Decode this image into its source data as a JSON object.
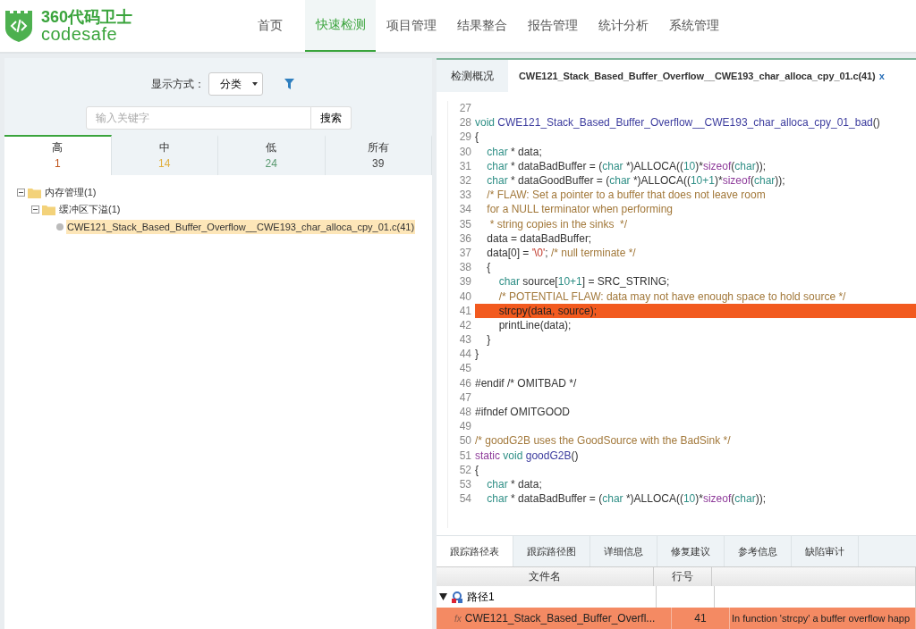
{
  "logo": {
    "title": "360代码卫士",
    "subtitle": "codesafe"
  },
  "nav": [
    {
      "label": "首页",
      "selected": false
    },
    {
      "label": "快速检测",
      "selected": true
    },
    {
      "label": "项目管理",
      "selected": false
    },
    {
      "label": "结果整合",
      "selected": false
    },
    {
      "label": "报告管理",
      "selected": false
    },
    {
      "label": "统计分析",
      "selected": false
    },
    {
      "label": "系统管理",
      "selected": false
    }
  ],
  "left": {
    "display_mode": {
      "label": "显示方式：",
      "value": "分类"
    },
    "search": {
      "placeholder": "输入关键字",
      "button": "搜索"
    },
    "severity_tabs": [
      {
        "label": "高",
        "count": "1",
        "color": "#c0561e",
        "selected": true
      },
      {
        "label": "中",
        "count": "14",
        "color": "#e0b040",
        "selected": false
      },
      {
        "label": "低",
        "count": "24",
        "color": "#5a9a70",
        "selected": false
      },
      {
        "label": "所有",
        "count": "39",
        "color": "#444444",
        "selected": false
      }
    ],
    "tree": [
      {
        "label": "内存管理(1)",
        "kind": "folder",
        "expanded": true,
        "selected": false,
        "children": [
          {
            "label": "缓冲区下溢(1)",
            "kind": "folder",
            "expanded": true,
            "selected": false,
            "children": [
              {
                "label": "CWE121_Stack_Based_Buffer_Overflow__CWE193_char_alloca_cpy_01.c(41)",
                "kind": "file",
                "selected": true
              }
            ]
          }
        ]
      }
    ]
  },
  "right": {
    "tabs": [
      {
        "label": "检测概况",
        "selected": false,
        "closable": false
      },
      {
        "label": "CWE121_Stack_Based_Buffer_Overflow__CWE193_char_alloca_cpy_01.c(41)",
        "selected": true,
        "closable": true,
        "close": "x"
      }
    ],
    "code": [
      {
        "num": "27",
        "highlight": false
      },
      {
        "num": "28",
        "highlight": false,
        "segs": [
          {
            "kind": "kw",
            "t": "void "
          },
          {
            "kind": "fn",
            "t": "CWE121_Stack_Based_Buffer_Overflow__CWE193_char_alloca_cpy_01_bad"
          },
          {
            "kind": "p",
            "t": "()"
          }
        ]
      },
      {
        "num": "29",
        "highlight": false,
        "segs": [
          {
            "kind": "p",
            "t": "{"
          }
        ]
      },
      {
        "num": "30",
        "highlight": false,
        "segs": [
          {
            "kind": "kw",
            "t": "    char"
          },
          {
            "kind": "p",
            "t": " * data;"
          }
        ]
      },
      {
        "num": "31",
        "highlight": false,
        "segs": [
          {
            "kind": "kw",
            "t": "    char"
          },
          {
            "kind": "p",
            "t": " * dataBadBuffer = ("
          },
          {
            "kind": "kw",
            "t": "char"
          },
          {
            "kind": "p",
            "t": " *)ALLOCA(("
          },
          {
            "kind": "num",
            "t": "10"
          },
          {
            "kind": "p",
            "t": ")*"
          },
          {
            "kind": "sz",
            "t": "sizeof"
          },
          {
            "kind": "p",
            "t": "("
          },
          {
            "kind": "kw",
            "t": "char"
          },
          {
            "kind": "p",
            "t": "));"
          }
        ]
      },
      {
        "num": "32",
        "highlight": false,
        "segs": [
          {
            "kind": "kw",
            "t": "    char"
          },
          {
            "kind": "p",
            "t": " * dataGoodBuffer = ("
          },
          {
            "kind": "kw",
            "t": "char"
          },
          {
            "kind": "p",
            "t": " *)ALLOCA(("
          },
          {
            "kind": "num",
            "t": "10+1"
          },
          {
            "kind": "p",
            "t": ")*"
          },
          {
            "kind": "sz",
            "t": "sizeof"
          },
          {
            "kind": "p",
            "t": "("
          },
          {
            "kind": "kw",
            "t": "char"
          },
          {
            "kind": "p",
            "t": "));"
          }
        ]
      },
      {
        "num": "33",
        "highlight": false,
        "segs": [
          {
            "kind": "cm",
            "t": "    /* FLAW: Set a pointer to a buffer that does not leave room"
          }
        ]
      },
      {
        "num": "34",
        "highlight": false,
        "segs": [
          {
            "kind": "cm",
            "t": "    for a NULL terminator when performing"
          }
        ]
      },
      {
        "num": "35",
        "highlight": false,
        "segs": [
          {
            "kind": "cm",
            "t": "     * string copies in the sinks  */"
          }
        ]
      },
      {
        "num": "36",
        "highlight": false,
        "segs": [
          {
            "kind": "p",
            "t": "    data = dataBadBuffer;"
          }
        ]
      },
      {
        "num": "37",
        "highlight": false,
        "segs": [
          {
            "kind": "p",
            "t": "    data[0] = "
          },
          {
            "kind": "str",
            "t": "'\\0'"
          },
          {
            "kind": "p",
            "t": "; "
          },
          {
            "kind": "cm",
            "t": "/* null terminate */"
          }
        ]
      },
      {
        "num": "38",
        "highlight": false,
        "segs": [
          {
            "kind": "p",
            "t": "    {"
          }
        ]
      },
      {
        "num": "39",
        "highlight": false,
        "segs": [
          {
            "kind": "kw",
            "t": "        char"
          },
          {
            "kind": "p",
            "t": " source["
          },
          {
            "kind": "num",
            "t": "10+1"
          },
          {
            "kind": "p",
            "t": "] = SRC_STRING;"
          }
        ]
      },
      {
        "num": "40",
        "highlight": false,
        "segs": [
          {
            "kind": "cm",
            "t": "        /* POTENTIAL FLAW: data may not have enough space to hold source */"
          }
        ]
      },
      {
        "num": "41",
        "highlight": true,
        "segs": [
          {
            "kind": "p",
            "t": "        strcpy(data, source);"
          }
        ]
      },
      {
        "num": "42",
        "highlight": false,
        "segs": [
          {
            "kind": "p",
            "t": "        printLine(data);"
          }
        ]
      },
      {
        "num": "43",
        "highlight": false,
        "segs": [
          {
            "kind": "p",
            "t": "    }"
          }
        ]
      },
      {
        "num": "44",
        "highlight": false,
        "segs": [
          {
            "kind": "p",
            "t": "}"
          }
        ]
      },
      {
        "num": "45",
        "highlight": false
      },
      {
        "num": "46",
        "highlight": false,
        "segs": [
          {
            "kind": "p",
            "t": "#endif /* OMITBAD */"
          }
        ]
      },
      {
        "num": "47",
        "highlight": false
      },
      {
        "num": "48",
        "highlight": false,
        "segs": [
          {
            "kind": "p",
            "t": "#ifndef OMITGOOD"
          }
        ]
      },
      {
        "num": "49",
        "highlight": false
      },
      {
        "num": "50",
        "highlight": false,
        "segs": [
          {
            "kind": "cm",
            "t": "/* goodG2B uses the GoodSource with the BadSink */"
          }
        ]
      },
      {
        "num": "51",
        "highlight": false,
        "segs": [
          {
            "kind": "sz",
            "t": "static "
          },
          {
            "kind": "kw",
            "t": "void "
          },
          {
            "kind": "fn",
            "t": "goodG2B"
          },
          {
            "kind": "p",
            "t": "()"
          }
        ]
      },
      {
        "num": "52",
        "highlight": false,
        "segs": [
          {
            "kind": "p",
            "t": "{"
          }
        ]
      },
      {
        "num": "53",
        "highlight": false,
        "segs": [
          {
            "kind": "kw",
            "t": "    char"
          },
          {
            "kind": "p",
            "t": " * data;"
          }
        ]
      },
      {
        "num": "54",
        "highlight": false,
        "segs": [
          {
            "kind": "kw",
            "t": "    char"
          },
          {
            "kind": "p",
            "t": " * dataBadBuffer = ("
          },
          {
            "kind": "kw",
            "t": "char"
          },
          {
            "kind": "p",
            "t": " *)ALLOCA(("
          },
          {
            "kind": "num",
            "t": "10"
          },
          {
            "kind": "p",
            "t": ")*"
          },
          {
            "kind": "sz",
            "t": "sizeof"
          },
          {
            "kind": "p",
            "t": "("
          },
          {
            "kind": "kw",
            "t": "char"
          },
          {
            "kind": "p",
            "t": "));"
          }
        ]
      }
    ],
    "bottom_tabs": [
      {
        "label": "跟踪路径表",
        "selected": true
      },
      {
        "label": "跟踪路径图",
        "selected": false
      },
      {
        "label": "详细信息",
        "selected": false
      },
      {
        "label": "修复建议",
        "selected": false
      },
      {
        "label": "参考信息",
        "selected": false
      },
      {
        "label": "缺陷审计",
        "selected": false
      }
    ],
    "table": {
      "columns": [
        "文件名",
        "行号"
      ],
      "groups": [
        {
          "label": "路径1",
          "expanded": true,
          "rows": [
            {
              "icon": "fx",
              "file": "CWE121_Stack_Based_Buffer_Overfl...",
              "line": "41",
              "message": "In function 'strcpy' a buffer overflow happ",
              "selected": true
            }
          ]
        }
      ]
    }
  }
}
